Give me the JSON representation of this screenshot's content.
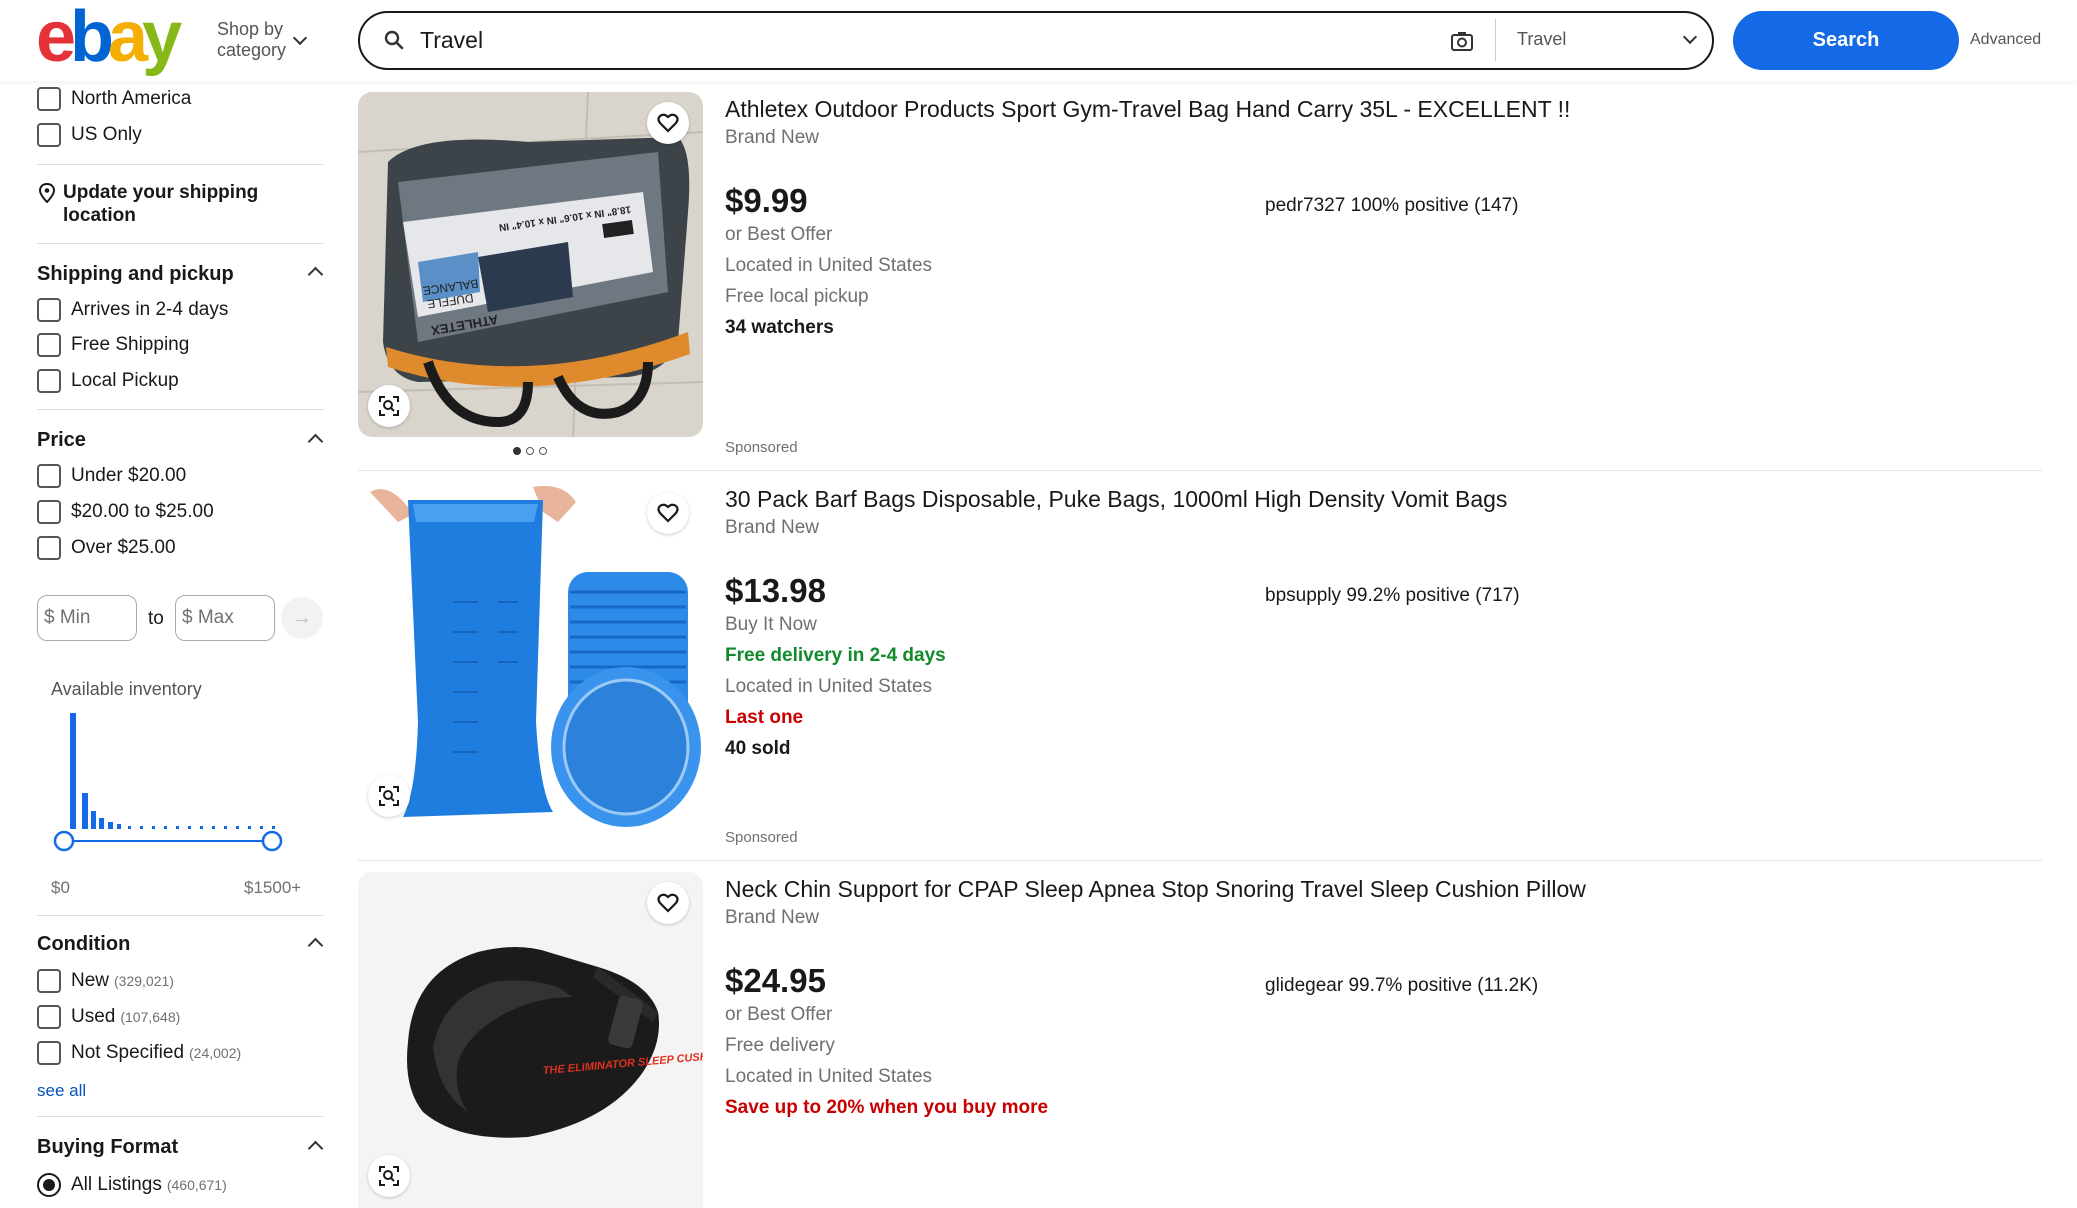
{
  "header": {
    "logo_letters": [
      "e",
      "b",
      "a",
      "y"
    ],
    "logo_colors": [
      "#e53238",
      "#0064d2",
      "#f5af02",
      "#86b817"
    ],
    "shop_by_line1": "Shop by",
    "shop_by_line2": "category",
    "search_value": "Travel",
    "category_value": "Travel",
    "search_button": "Search",
    "advanced_link": "Advanced"
  },
  "sidebar": {
    "location_options": [
      {
        "label": "North America"
      },
      {
        "label": "US Only"
      }
    ],
    "update_shipping": "Update your shipping location",
    "shipping": {
      "title": "Shipping and pickup",
      "options": [
        {
          "label": "Arrives in 2-4 days"
        },
        {
          "label": "Free Shipping"
        },
        {
          "label": "Local Pickup"
        }
      ]
    },
    "price": {
      "title": "Price",
      "options": [
        {
          "label": "Under $20.00"
        },
        {
          "label": "$20.00 to $25.00"
        },
        {
          "label": "Over $25.00"
        }
      ],
      "min_placeholder": "$ Min",
      "to_label": "to",
      "max_placeholder": "$ Max",
      "go_icon": "arrow-right-icon"
    },
    "inventory": {
      "label": "Available inventory",
      "low": "$0",
      "high": "$1500+"
    },
    "condition": {
      "title": "Condition",
      "options": [
        {
          "label": "New",
          "count": "(329,021)"
        },
        {
          "label": "Used",
          "count": "(107,648)"
        },
        {
          "label": "Not Specified",
          "count": "(24,002)"
        }
      ],
      "see_all": "see all"
    },
    "buying_format": {
      "title": "Buying Format",
      "options": [
        {
          "label": "All Listings",
          "count": "(460,671)",
          "selected": true
        }
      ]
    }
  },
  "listings": [
    {
      "title": "Athletex Outdoor Products Sport Gym-Travel Bag Hand Carry 35L - EXCELLENT !!",
      "condition": "Brand New",
      "price": "$9.99",
      "seller": "pedr7327 100% positive (147)",
      "line1": "or Best Offer",
      "line2": "Located in United States",
      "line3": "Free local pickup",
      "line4": "34 watchers",
      "sponsored": "Sponsored"
    },
    {
      "title": "30 Pack Barf Bags Disposable, Puke Bags, 1000ml High Density Vomit Bags",
      "condition": "Brand New",
      "price": "$13.98",
      "seller": "bpsupply 99.2% positive (717)",
      "line1": "Buy It Now",
      "line2": "Free delivery in 2-4 days",
      "line3": "Located in United States",
      "line4": "Last one",
      "line5": "40 sold",
      "sponsored": "Sponsored"
    },
    {
      "title": "Neck Chin Support for CPAP Sleep Apnea Stop Snoring Travel Sleep Cushion Pillow",
      "condition": "Brand New",
      "price": "$24.95",
      "seller": "glidegear 99.7% positive (11.2K)",
      "line1": "or Best Offer",
      "line2": "Free delivery",
      "line3": "Located in United States",
      "line4": "Save up to 20% when you buy more",
      "product_print": "THE ELIMINATOR SLEEP CUSHION"
    }
  ],
  "athletex_bag_print": {
    "brand": "ATHLETEX",
    "dims": "18.8\" IN x 10.6\" IN x 10.4\" IN",
    "model_1": "BALANCE",
    "model_2": "DUFFLE"
  },
  "colors": {
    "primary_blue": "#1369e6",
    "link_blue": "#0654ba",
    "green": "#118a2c",
    "red": "#c90000"
  }
}
